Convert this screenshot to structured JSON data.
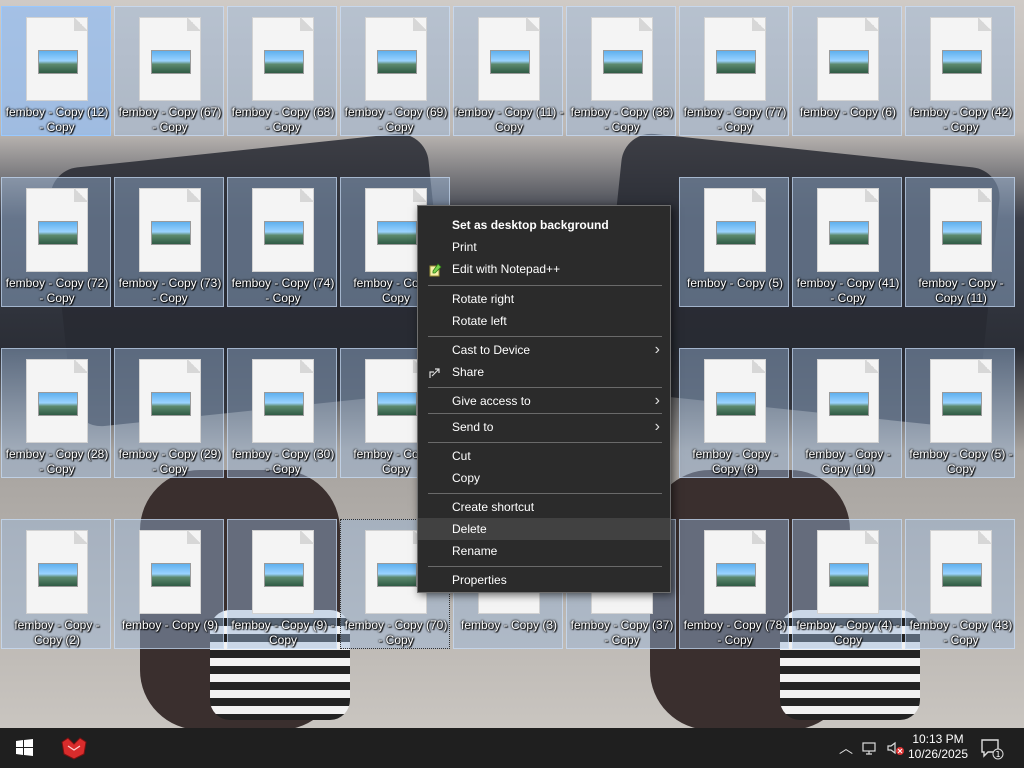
{
  "desktop": {
    "icons": [
      {
        "label": "femboy - Copy (12) - Copy"
      },
      {
        "label": "femboy - Copy (67) - Copy"
      },
      {
        "label": "femboy - Copy (68) - Copy"
      },
      {
        "label": "femboy - Copy (69) - Copy"
      },
      {
        "label": "femboy - Copy (11) - Copy"
      },
      {
        "label": "femboy - Copy (36) - Copy"
      },
      {
        "label": "femboy - Copy (77) - Copy"
      },
      {
        "label": "femboy - Copy (6)"
      },
      {
        "label": "femboy - Copy (42) - Copy"
      },
      {
        "label": "femboy - Copy (72) - Copy"
      },
      {
        "label": "femboy - Copy (73) - Copy"
      },
      {
        "label": "femboy - Copy (74) - Copy"
      },
      {
        "label": "femboy - Copy - Copy"
      },
      {
        "label": ""
      },
      {
        "label": ""
      },
      {
        "label": "femboy - Copy (5)"
      },
      {
        "label": "femboy - Copy (41) - Copy"
      },
      {
        "label": "femboy - Copy - Copy (11)"
      },
      {
        "label": "femboy - Copy (28) - Copy"
      },
      {
        "label": "femboy - Copy (29) - Copy"
      },
      {
        "label": "femboy - Copy (30) - Copy"
      },
      {
        "label": "femboy - Copy - Copy"
      },
      {
        "label": ""
      },
      {
        "label": ""
      },
      {
        "label": "femboy - Copy - Copy (8)"
      },
      {
        "label": "femboy - Copy - Copy (10)"
      },
      {
        "label": "femboy - Copy (5) - Copy"
      },
      {
        "label": "femboy - Copy - Copy (2)"
      },
      {
        "label": "femboy - Copy (9)"
      },
      {
        "label": "femboy - Copy (9) - Copy"
      },
      {
        "label": "femboy - Copy (70) - Copy"
      },
      {
        "label": "femboy - Copy (3)"
      },
      {
        "label": "femboy - Copy (37) - Copy"
      },
      {
        "label": "femboy - Copy (78) - Copy"
      },
      {
        "label": "femboy - Copy (4) - Copy"
      },
      {
        "label": "femboy - Copy (43) - Copy"
      }
    ]
  },
  "context_menu": {
    "items": [
      {
        "label": "Set as desktop background",
        "bold": true
      },
      {
        "label": "Print"
      },
      {
        "label": "Edit with Notepad++",
        "icon": "notepadpp-icon"
      },
      {
        "label": "Rotate right"
      },
      {
        "label": "Rotate left"
      },
      {
        "label": "Cast to Device",
        "submenu": true
      },
      {
        "label": "Share",
        "icon": "share-icon"
      },
      {
        "label": "Give access to",
        "submenu": true
      },
      {
        "label": "Send to",
        "submenu": true
      },
      {
        "label": "Cut"
      },
      {
        "label": "Copy"
      },
      {
        "label": "Create shortcut"
      },
      {
        "label": "Delete",
        "highlighted": true
      },
      {
        "label": "Rename"
      },
      {
        "label": "Properties"
      }
    ]
  },
  "taskbar": {
    "time": "10:13 PM",
    "date": "10/26/2025",
    "notification_count": "1",
    "icons": {
      "start": "windows-logo-icon",
      "pinned_app": "red-fox-app-icon",
      "tray_up": "chevron-up-icon",
      "network": "network-icon",
      "volume": "volume-muted-icon",
      "notifications": "action-center-icon"
    }
  },
  "colors": {
    "menu_bg": "#2b2b2b",
    "menu_hover": "#414141",
    "taskbar_bg": "#1f1f1f",
    "selection_fill": "rgba(155,185,220,0.45)"
  }
}
